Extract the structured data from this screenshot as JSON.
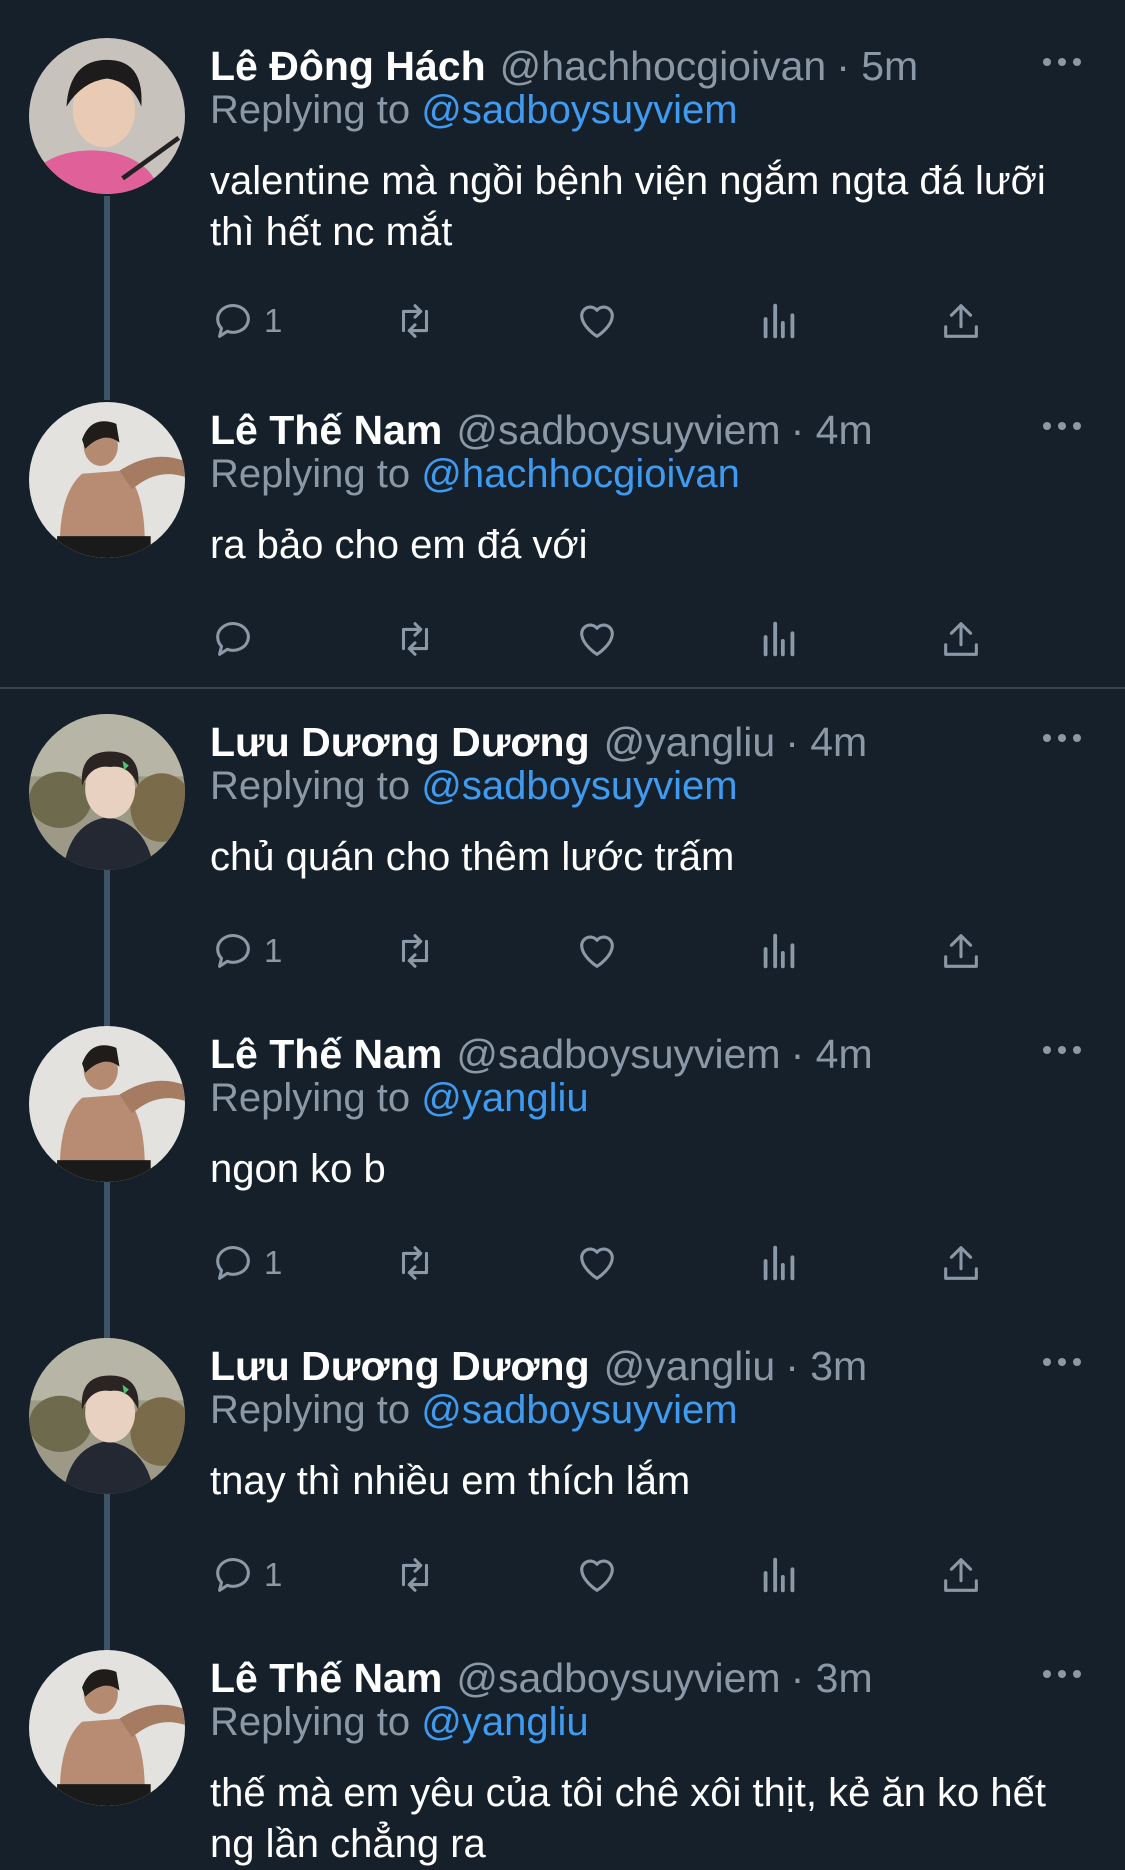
{
  "tweets": [
    {
      "name": "Lê Đông Hách",
      "handle": "@hachhocgioivan",
      "time": "· 5m",
      "replying_label": "Replying to",
      "replying_to": "@sadboysuyviem",
      "text": "valentine mà ngồi bệnh viện ngắm ngta đá lưỡi thì hết nc mắt",
      "reply_count": "1"
    },
    {
      "name": "Lê Thế Nam",
      "handle": "@sadboysuyviem",
      "time": "· 4m",
      "replying_label": "Replying to",
      "replying_to": "@hachhocgioivan",
      "text": "ra bảo cho em đá với",
      "reply_count": ""
    },
    {
      "name": "Lưu Dương Dương",
      "handle": "@yangliu",
      "time": "· 4m",
      "replying_label": "Replying to",
      "replying_to": "@sadboysuyviem",
      "text": "chủ quán cho thêm lước trấm",
      "reply_count": "1"
    },
    {
      "name": "Lê Thế Nam",
      "handle": "@sadboysuyviem",
      "time": "· 4m",
      "replying_label": "Replying to",
      "replying_to": "@yangliu",
      "text": "ngon ko b",
      "reply_count": "1"
    },
    {
      "name": "Lưu Dương Dương",
      "handle": "@yangliu",
      "time": "· 3m",
      "replying_label": "Replying to",
      "replying_to": "@sadboysuyviem",
      "text": "tnay thì nhiều em thích lắm",
      "reply_count": "1"
    },
    {
      "name": "Lê Thế Nam",
      "handle": "@sadboysuyviem",
      "time": "· 3m",
      "replying_label": "Replying to",
      "replying_to": "@yangliu",
      "text": "thế mà em yêu của tôi chê xôi thịt, kẻ ăn ko hết ng lần chẳng ra",
      "reply_count": ""
    }
  ],
  "icons": {
    "reply": "reply-icon",
    "retweet": "retweet-icon",
    "like": "heart-icon",
    "analytics": "analytics-icon",
    "share": "share-icon",
    "more": "more-icon"
  },
  "colors": {
    "background": "#15202b",
    "accent": "#3f9bf0",
    "secondary_text": "#8b98a5",
    "divider": "#38444d"
  }
}
